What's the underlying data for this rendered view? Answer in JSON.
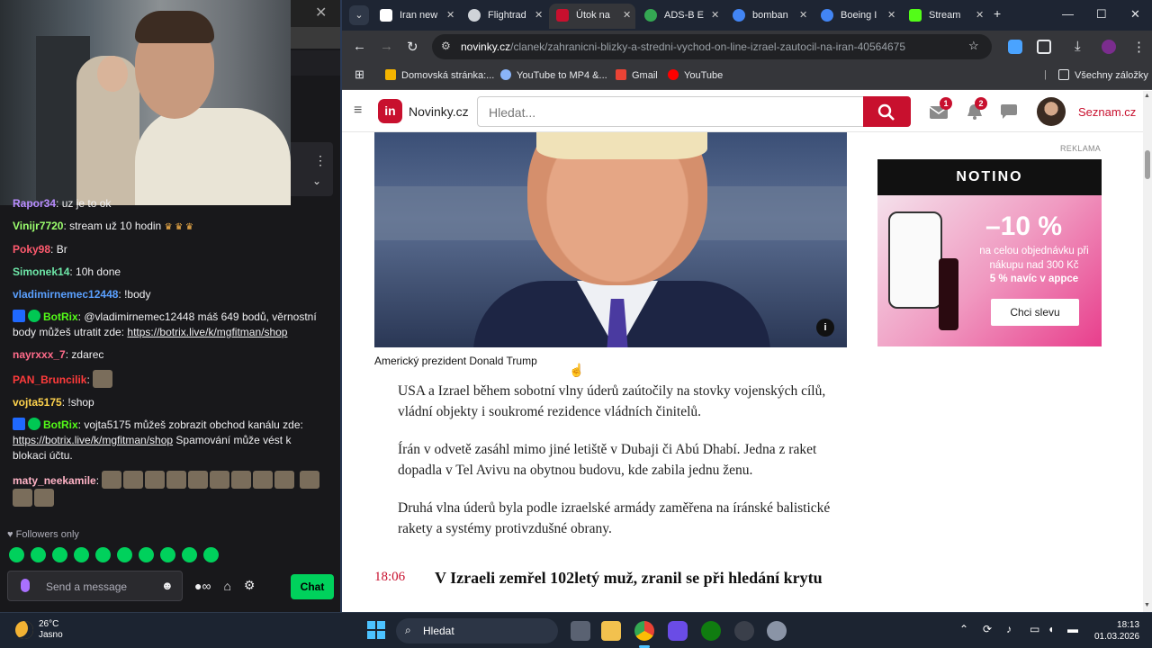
{
  "chat": {
    "messages": [
      {
        "user": "Rapor34",
        "color": "#b98cff",
        "text": "uz je to ok"
      },
      {
        "user": "Vinijr7720",
        "color": "#9cff6e",
        "text": "stream už 10 hodin"
      },
      {
        "user": "Poky98",
        "color": "#ff5a6e",
        "text": "Br"
      },
      {
        "user": "Simonek14",
        "color": "#6ee7a8",
        "text": "10h done"
      },
      {
        "user": "vladimirnemec12448",
        "color": "#5aa0ff",
        "text": "!body"
      }
    ],
    "botrix1": {
      "user": "BotRix",
      "text": "@vladimirnemec12448 máš 649 bodů, věrnostní body můžeš utratit zde: ",
      "link": "https://botrix.live/k/mgfitman/shop"
    },
    "msg_nayrxxx": {
      "user": "nayrxxx_7",
      "text": "zdarec"
    },
    "msg_pan": {
      "user": "PAN_Bruncilik"
    },
    "msg_vojta": {
      "user": "vojta5175",
      "text": "!shop"
    },
    "botrix2": {
      "user": "BotRix",
      "text": "vojta5175 můžeš zobrazit obchod kanálu zde: ",
      "link": "https://botrix.live/k/mgfitman/shop",
      "tail": " Spamování může vést k blokaci účtu."
    },
    "msg_maty": {
      "user": "maty_neekamile"
    },
    "followers_only": "Followers only",
    "input_placeholder": "Send a message",
    "chat_button": "Chat"
  },
  "browser": {
    "tabs": [
      {
        "label": "Iran new",
        "fav_color": "#ffffff"
      },
      {
        "label": "Flightrad",
        "fav_color": "#cfd3d8"
      },
      {
        "label": "Útok na",
        "fav_color": "#c8102e"
      },
      {
        "label": "ADS-B E",
        "fav_color": "#34a853"
      },
      {
        "label": "bomban",
        "fav_color": "#4285f4"
      },
      {
        "label": "Boeing I",
        "fav_color": "#4285f4"
      },
      {
        "label": "Stream",
        "fav_color": "#53fc18"
      }
    ],
    "url_domain": "novinky.cz",
    "url_path": "/clanek/zahranicni-blizky-a-stredni-vychod-on-line-izrael-zautocil-na-iran-40564675",
    "bookmarks": [
      {
        "label": "Domovská stránka:...",
        "color": "#f4b400"
      },
      {
        "label": "YouTube to MP4 &...",
        "color": "#8ab4f8"
      },
      {
        "label": "Gmail",
        "color": "#ea4335"
      },
      {
        "label": "YouTube",
        "color": "#ff0000"
      }
    ],
    "bookmarks_all": "Všechny záložky"
  },
  "site": {
    "logo_mark": "in",
    "logo_text": "Novinky.cz",
    "search_placeholder": "Hledat...",
    "mail_count": "1",
    "notif_count": "2",
    "seznam": "Seznam.cz",
    "caption": "Americký prezident Donald Trump",
    "paragraphs": [
      "USA a Izrael během sobotní vlny úderů zaútočily na stovky vojenských cílů, vládní objekty i soukromé rezidence vládních činitelů.",
      "Írán v odvetě zasáhl mimo jiné letiště v Dubaji či Abú Dhabí. Jedna z raket dopadla v Tel Avivu na obytnou budovu, kde zabila jednu ženu.",
      "Druhá vlna úderů byla podle izraelské armády zaměřena na íránské balistické rakety a systémy protivzdušné obrany."
    ],
    "timeline_time": "18:06",
    "timeline_headline": "V Izraeli zemřel 102letý muž, zranil se při hledání krytu",
    "reklama": "REKLAMA",
    "ad": {
      "brand": "NOTINO",
      "discount": "–10 %",
      "line1": "na celou objednávku při nákupu nad 300 Kč",
      "line2": "5 % navíc v appce",
      "cta": "Chci slevu"
    }
  },
  "taskbar": {
    "temp": "26°C",
    "weather": "Jasno",
    "search": "Hledat",
    "time": "18:13",
    "date": "01.03.2026"
  }
}
